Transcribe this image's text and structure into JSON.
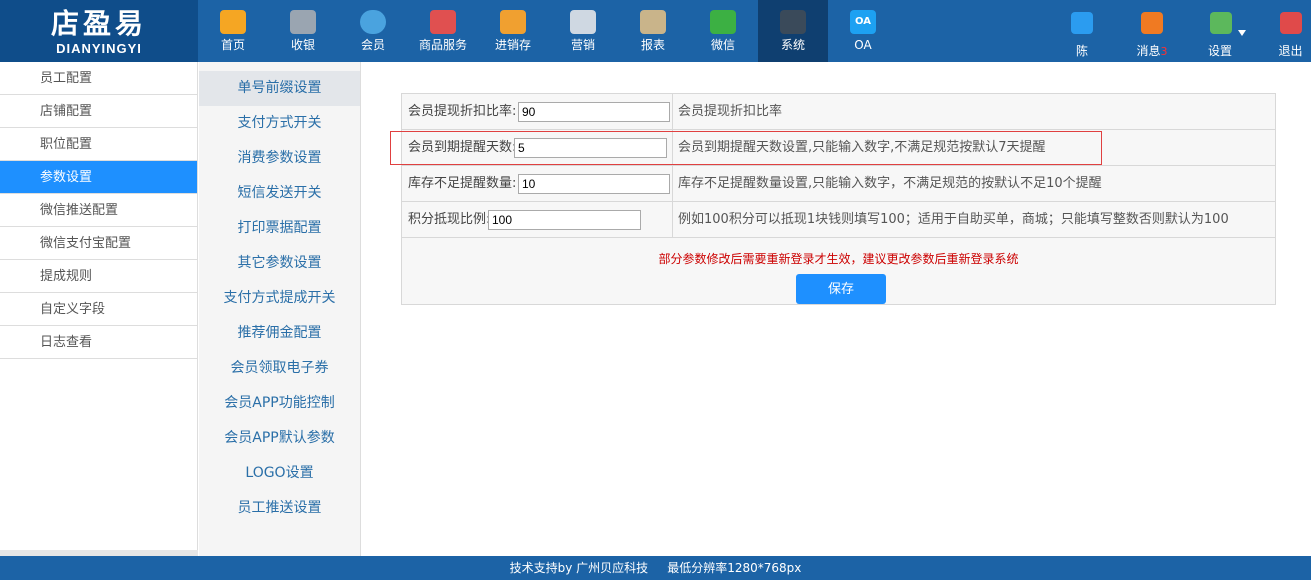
{
  "logo": {
    "cn": "店盈易",
    "en": "DIANYINGYI"
  },
  "nav": [
    {
      "label": "首页",
      "icon": "home-icon",
      "color": "#f5a623"
    },
    {
      "label": "收银",
      "icon": "cash-register-icon",
      "color": "#9aa5b1"
    },
    {
      "label": "会员",
      "icon": "member-icon",
      "color": "#4aa3df"
    },
    {
      "label": "商品服务",
      "icon": "goods-icon",
      "color": "#e05050"
    },
    {
      "label": "进销存",
      "icon": "inventory-icon",
      "color": "#f0a030"
    },
    {
      "label": "营销",
      "icon": "megaphone-icon",
      "color": "#cfd8e2"
    },
    {
      "label": "报表",
      "icon": "report-icon",
      "color": "#c9b48a"
    },
    {
      "label": "微信",
      "icon": "wechat-icon",
      "color": "#3cb043"
    },
    {
      "label": "系统",
      "icon": "monitor-icon",
      "color": "#3a4a5a"
    },
    {
      "label": "OA",
      "icon": "oa-icon",
      "color": "#1da1f2"
    }
  ],
  "right_nav": [
    {
      "label": "陈",
      "icon": "user-icon",
      "color": "#2b9cf0"
    },
    {
      "label": "消息",
      "badge": "3",
      "icon": "bell-icon",
      "color": "#f07a22"
    },
    {
      "label": "设置",
      "icon": "settings-gear-icon",
      "color": "#5cb85c"
    },
    {
      "label": "退出",
      "icon": "logout-icon",
      "color": "#e04a4a"
    }
  ],
  "left_menu": [
    "员工配置",
    "店铺配置",
    "职位配置",
    "参数设置",
    "微信推送配置",
    "微信支付宝配置",
    "提成规则",
    "自定义字段",
    "日志查看"
  ],
  "mid_menu": [
    "单号前缀设置",
    "支付方式开关",
    "消费参数设置",
    "短信发送开关",
    "打印票据配置",
    "其它参数设置",
    "支付方式提成开关",
    "推荐佣金配置",
    "会员领取电子券",
    "会员APP功能控制",
    "会员APP默认参数",
    "LOGO设置",
    "员工推送设置"
  ],
  "params": [
    {
      "label": "会员提现折扣比率:",
      "value": "90",
      "desc": "会员提现折扣比率"
    },
    {
      "label": "会员到期提醒天数:",
      "value": "5",
      "desc": "会员到期提醒天数设置,只能输入数字,不满足规范按默认7天提醒"
    },
    {
      "label": "库存不足提醒数量:",
      "value": "10",
      "desc": "库存不足提醒数量设置,只能输入数字，不满足规范的按默认不足10个提醒"
    },
    {
      "label": "积分抵现比例:",
      "value": "100",
      "desc": "例如100积分可以抵现1块钱则填写100；适用于自助买单，商城；只能填写整数否则默认为100"
    }
  ],
  "notice": "部分参数修改后需要重新登录才生效，建议更改参数后重新登录系统",
  "save_label": "保存",
  "footer": "技术支持by 广州贝应科技     最低分辨率1280*768px"
}
